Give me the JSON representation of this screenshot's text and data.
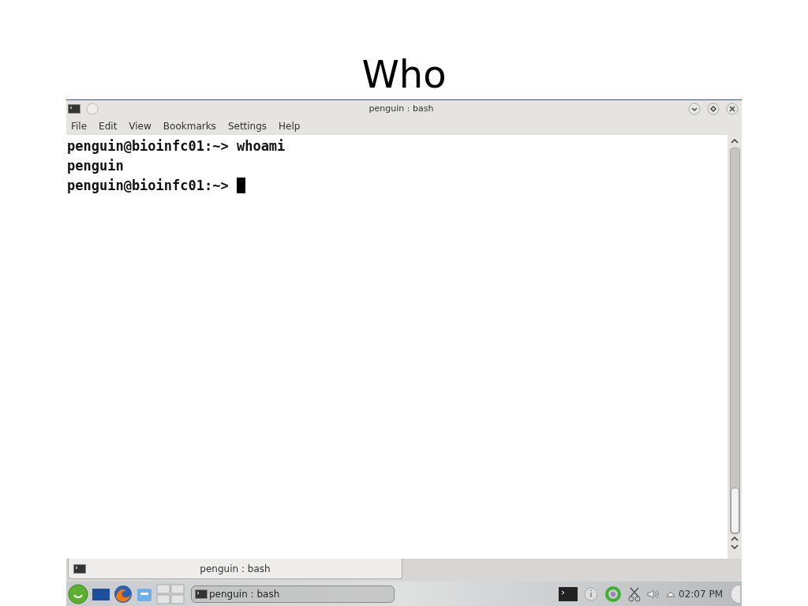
{
  "slide": {
    "title": "Who"
  },
  "window": {
    "title": "penguin : bash"
  },
  "menu": [
    "File",
    "Edit",
    "View",
    "Bookmarks",
    "Settings",
    "Help"
  ],
  "terminal": {
    "lines": [
      "penguin@bioinfc01:~> whoami",
      "penguin",
      "penguin@bioinfc01:~> "
    ]
  },
  "tabs": [
    {
      "label": "penguin : bash",
      "selected": true
    }
  ],
  "taskbar": {
    "tasks": [
      {
        "label": "penguin : bash",
        "selected": false
      }
    ],
    "clock": "02:07 PM"
  }
}
